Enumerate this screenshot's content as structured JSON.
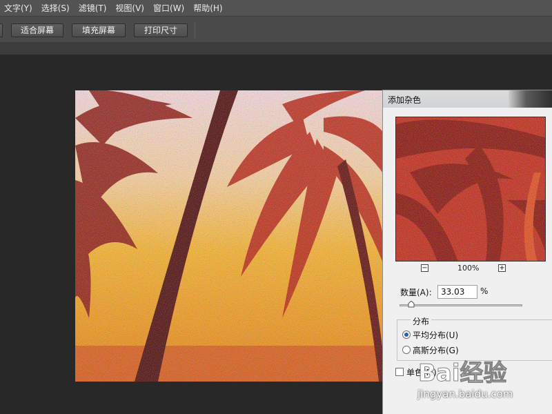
{
  "menu": [
    "文字(Y)",
    "选择(S)",
    "滤镜(T)",
    "视图(V)",
    "窗口(W)",
    "帮助(H)"
  ],
  "options": {
    "fit_screen": "适合屏幕",
    "fill_screen": "填充屏幕",
    "print_size": "打印尺寸"
  },
  "dialog": {
    "title": "添加杂色",
    "zoom": "100%",
    "zoom_out": "−",
    "zoom_in": "+",
    "amount_label": "数量(A):",
    "amount_value": "33.03",
    "amount_unit": "%",
    "amount_fraction": 0.0825,
    "distribution_label": "分布",
    "uniform_label": "平均分布(U)",
    "uniform_selected": true,
    "gaussian_label": "高斯分布(G)",
    "gaussian_selected": false,
    "monochromatic_label": "单色(M)",
    "monochromatic_checked": false
  },
  "watermark": {
    "logo": "Bai经验",
    "url": "jingyan.baidu.com"
  },
  "colors": {
    "menubar": "#535353",
    "workspace": "#282828",
    "dialog_bg": "#f0f0f0",
    "sky_top": "#f4e2e0",
    "sky_bottom": "#f0a010",
    "palm": "#a8250f"
  },
  "icons": [
    "zoom-out-icon",
    "zoom-in-icon",
    "slider-thumb-icon",
    "paw-logo-icon"
  ]
}
